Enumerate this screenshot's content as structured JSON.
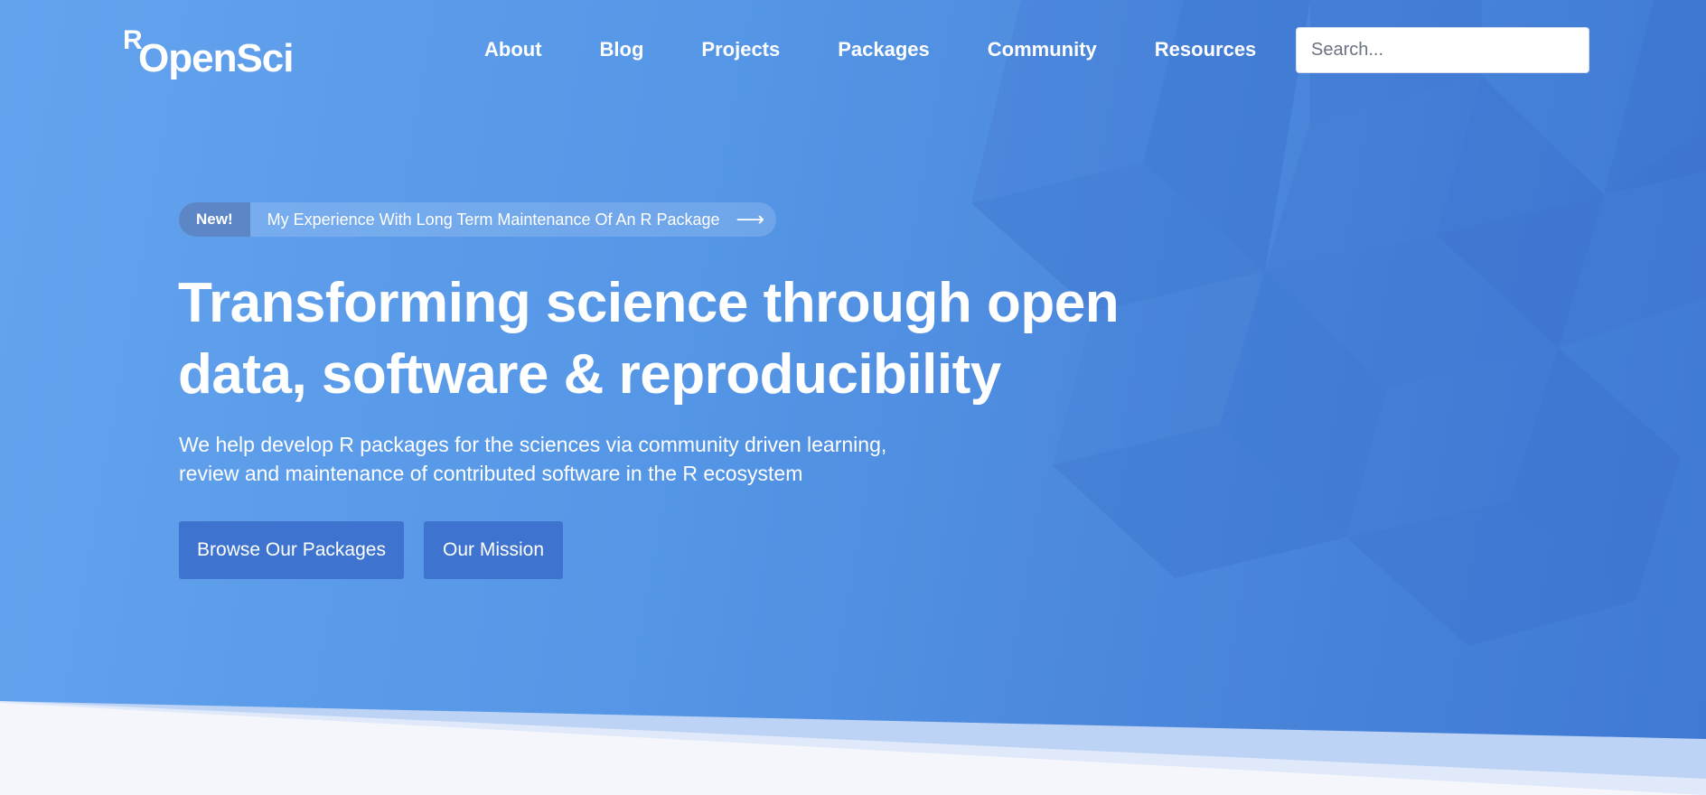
{
  "header": {
    "logo": {
      "r": "R",
      "text": "OpenSci"
    },
    "nav": [
      {
        "label": "About"
      },
      {
        "label": "Blog"
      },
      {
        "label": "Projects"
      },
      {
        "label": "Packages"
      },
      {
        "label": "Community"
      },
      {
        "label": "Resources"
      }
    ],
    "search": {
      "placeholder": "Search...",
      "value": ""
    }
  },
  "hero": {
    "announcement": {
      "badge": "New!",
      "text": "My Experience With Long Term Maintenance Of An R Package",
      "arrow_icon": "arrow-right-icon",
      "arrow_glyph": "⟶"
    },
    "headline_line1": "Transforming science through open",
    "headline_line2": "data, software & reproducibility",
    "subtext_line1": "We help develop R packages for the sciences via community driven learning,",
    "subtext_line2": "review and maintenance of contributed software in the R ecosystem",
    "buttons": {
      "primary": "Browse Our Packages",
      "secondary": "Our Mission"
    }
  },
  "colors": {
    "hero_gradient_start": "#63a3ee",
    "hero_gradient_end": "#3f79d4",
    "button_bg": "#3e74cf",
    "badge_bg": "#5c86c6",
    "page_bg": "#f4f6fb"
  }
}
